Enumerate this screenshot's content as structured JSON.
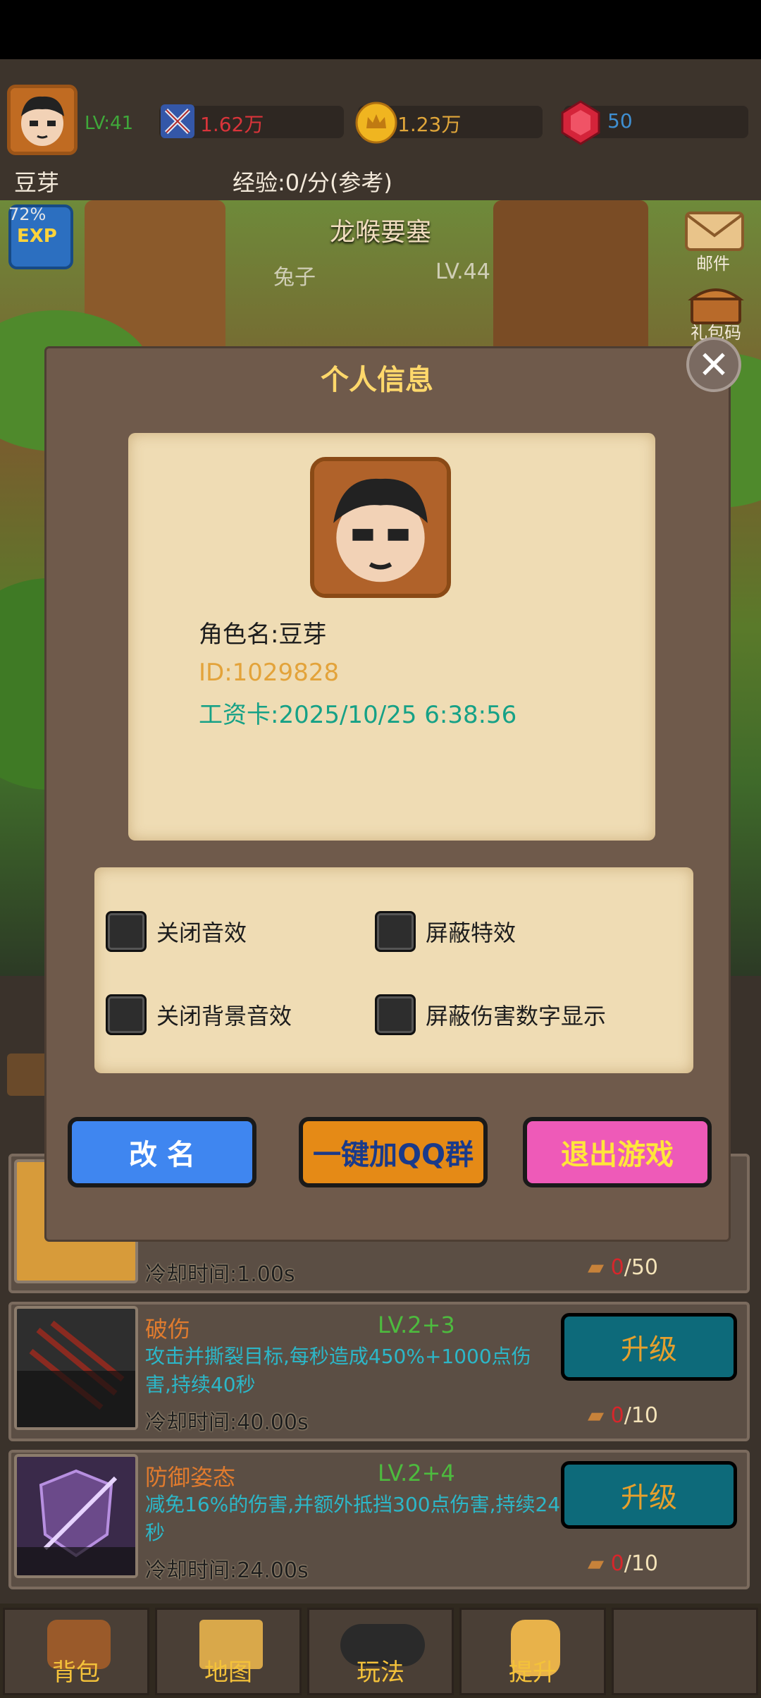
{
  "hud": {
    "level": "LV:41",
    "power": "1.62万",
    "gold": "1.23万",
    "gems": "50",
    "player_name": "豆芽",
    "exp_rate": "经验:0/分(参考)",
    "exp_percent": "72%",
    "exp_badge": "EXP"
  },
  "stage": {
    "name": "龙喉要塞",
    "enemy": "兔子",
    "enemy_level": "LV.44"
  },
  "side_buttons": {
    "mail": "邮件",
    "gift_code": "礼包码"
  },
  "modal": {
    "title": "个人信息",
    "role_name": "角色名:豆芽",
    "player_id": "ID:1029828",
    "salary_card": "工资卡:2025/10/25 6:38:56",
    "settings": [
      {
        "label": "关闭音效",
        "checked": false
      },
      {
        "label": "屏蔽特效",
        "checked": false
      },
      {
        "label": "关闭背景音效",
        "checked": false
      },
      {
        "label": "屏蔽伤害数字显示",
        "checked": false
      }
    ],
    "buttons": {
      "rename": "改 名",
      "join_qq": "一键加QQ群",
      "quit": "退出游戏"
    }
  },
  "skills": [
    {
      "name": "",
      "level": "",
      "description": "",
      "cooldown": "冷却时间:1.00s",
      "books_have": "0",
      "books_need": "/50",
      "upgrade": ""
    },
    {
      "name": "破伤",
      "level": "LV.2+3",
      "description": "攻击并撕裂目标,每秒造成450%+1000点伤害,持续40秒",
      "cooldown": "冷却时间:40.00s",
      "books_have": "0",
      "books_need": "/10",
      "upgrade": "升级"
    },
    {
      "name": "防御姿态",
      "level": "LV.2+4",
      "description": "减免16%的伤害,并额外抵挡300点伤害,持续24秒",
      "cooldown": "冷却时间:24.00s",
      "books_have": "0",
      "books_need": "/10",
      "upgrade": "升级"
    }
  ],
  "nav": [
    "背包",
    "地图",
    "玩法",
    "提升"
  ],
  "colors": {
    "rename_btn": "#3f86f0",
    "join_qq_btn": "#e58a16",
    "quit_btn": "#ee5ab8",
    "title": "#ffd86b",
    "salary": "#16a186",
    "id": "#e3a33a"
  }
}
